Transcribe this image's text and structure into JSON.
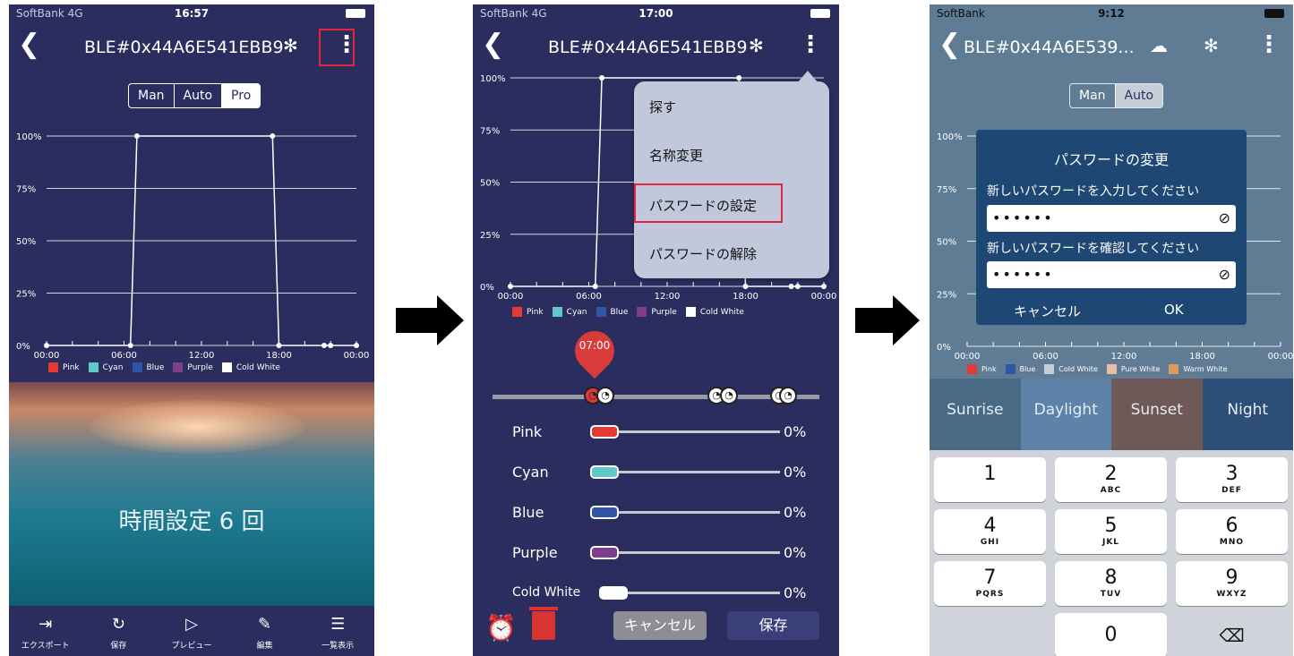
{
  "colors": {
    "bg": "#2b2d5e",
    "highlight": "#e2263f",
    "pink": "#e53935",
    "cyan": "#5fc9c9",
    "blue": "#2f55a8",
    "purple": "#7b3f8e",
    "cold_white": "#ffffff",
    "pure_white": "#e8bfa6",
    "warm_white": "#e09a5a"
  },
  "screen1": {
    "status": {
      "carrier": "SoftBank 4G",
      "time": "16:57"
    },
    "nav": {
      "back_icon": "chevron-left-icon",
      "title": "BLE#0x44A6E541EBB9",
      "bt_icon": "bluetooth-icon",
      "more_icon": "more-vertical-icon"
    },
    "modes": [
      "Man",
      "Auto",
      "Pro"
    ],
    "modes_selected": "Pro",
    "hero_text": "時間設定 6 回",
    "bottom_nav": [
      {
        "label": "エクスポート",
        "icon": "export-icon"
      },
      {
        "label": "保存",
        "icon": "save-icon"
      },
      {
        "label": "プレビュー",
        "icon": "play-icon"
      },
      {
        "label": "編集",
        "icon": "edit-icon"
      },
      {
        "label": "一覧表示",
        "icon": "list-icon"
      }
    ]
  },
  "screen2": {
    "status": {
      "carrier": "SoftBank 4G",
      "time": "17:00"
    },
    "nav": {
      "back_icon": "chevron-left-icon",
      "title": "BLE#0x44A6E541EBB9",
      "bt_icon": "bluetooth-icon",
      "more_icon": "more-vertical-icon"
    },
    "menu": [
      "探す",
      "名称変更",
      "パスワードの設定",
      "パスワードの解除"
    ],
    "menu_highlighted": "パスワードの設定",
    "pin_time": "07:00",
    "channels": [
      {
        "name": "Pink",
        "value": "0%"
      },
      {
        "name": "Cyan",
        "value": "0%"
      },
      {
        "name": "Blue",
        "value": "0%"
      },
      {
        "name": "Purple",
        "value": "0%"
      },
      {
        "name": "Cold White",
        "value": "0%"
      }
    ],
    "cancel_label": "キャンセル",
    "save_label": "保存",
    "alarm_icon": "alarm-add-icon",
    "trash_icon": "trash-icon"
  },
  "screen3": {
    "status": {
      "carrier": "SoftBank",
      "time": "9:12"
    },
    "nav": {
      "back_icon": "chevron-left-icon",
      "title": "BLE#0x44A6E539...",
      "cloud_icon": "cloud-sync-icon",
      "bt_icon": "bluetooth-icon",
      "more_icon": "more-vertical-icon"
    },
    "modes": [
      "Man",
      "Auto"
    ],
    "modes_selected": "Auto",
    "dialog": {
      "title": "パスワードの変更",
      "label1": "新しいパスワードを入力してください",
      "value1": "••••••",
      "label2": "新しいパスワードを確認してください",
      "value2": "••••••",
      "eye_icon": "eye-off-icon",
      "cancel": "キャンセル",
      "ok": "OK"
    },
    "scenes": [
      "Sunrise",
      "Daylight",
      "Sunset",
      "Night"
    ],
    "keys": [
      {
        "d": "1",
        "l": ""
      },
      {
        "d": "2",
        "l": "ABC"
      },
      {
        "d": "3",
        "l": "DEF"
      },
      {
        "d": "4",
        "l": "GHI"
      },
      {
        "d": "5",
        "l": "JKL"
      },
      {
        "d": "6",
        "l": "MNO"
      },
      {
        "d": "7",
        "l": "PQRS"
      },
      {
        "d": "8",
        "l": "TUV"
      },
      {
        "d": "9",
        "l": "WXYZ"
      },
      {
        "d": "0",
        "l": ""
      }
    ],
    "delete_icon": "backspace-icon"
  },
  "chart_data": [
    {
      "type": "line",
      "y_ticks": [
        "0%",
        "25%",
        "50%",
        "75%",
        "100%"
      ],
      "x_ticks": [
        "00:00",
        "06:00",
        "12:00",
        "18:00",
        "00:00"
      ],
      "legend": [
        "Pink",
        "Cyan",
        "Blue",
        "Purple",
        "Cold White"
      ],
      "ylim": [
        0,
        100
      ],
      "series": [
        {
          "name": "Cold White",
          "x": [
            0,
            6.5,
            7,
            17.5,
            18,
            21.5,
            22,
            24
          ],
          "y": [
            0,
            0,
            100,
            100,
            0,
            0,
            0,
            0
          ]
        }
      ]
    },
    {
      "type": "line",
      "y_ticks": [
        "0%",
        "25%",
        "50%",
        "75%",
        "100%"
      ],
      "x_ticks": [
        "00:00",
        "06:00",
        "12:00",
        "18:00",
        "00:00"
      ],
      "legend": [
        "Pink",
        "Cyan",
        "Blue",
        "Purple",
        "Cold White"
      ],
      "ylim": [
        0,
        100
      ],
      "series": [
        {
          "name": "Cold White",
          "x": [
            0,
            6.5,
            7,
            17.5,
            18,
            21.5,
            22,
            24
          ],
          "y": [
            0,
            0,
            100,
            100,
            0,
            0,
            0,
            0
          ]
        }
      ]
    },
    {
      "type": "line",
      "y_ticks": [
        "0%",
        "25%",
        "50%",
        "75%",
        "100%"
      ],
      "x_ticks": [
        "00:00",
        "06:00",
        "12:00",
        "18:00",
        "00:00"
      ],
      "legend": [
        "Pink",
        "Blue",
        "Cold White",
        "Pure White",
        "Warm White"
      ],
      "ylim": [
        0,
        100
      ]
    }
  ]
}
